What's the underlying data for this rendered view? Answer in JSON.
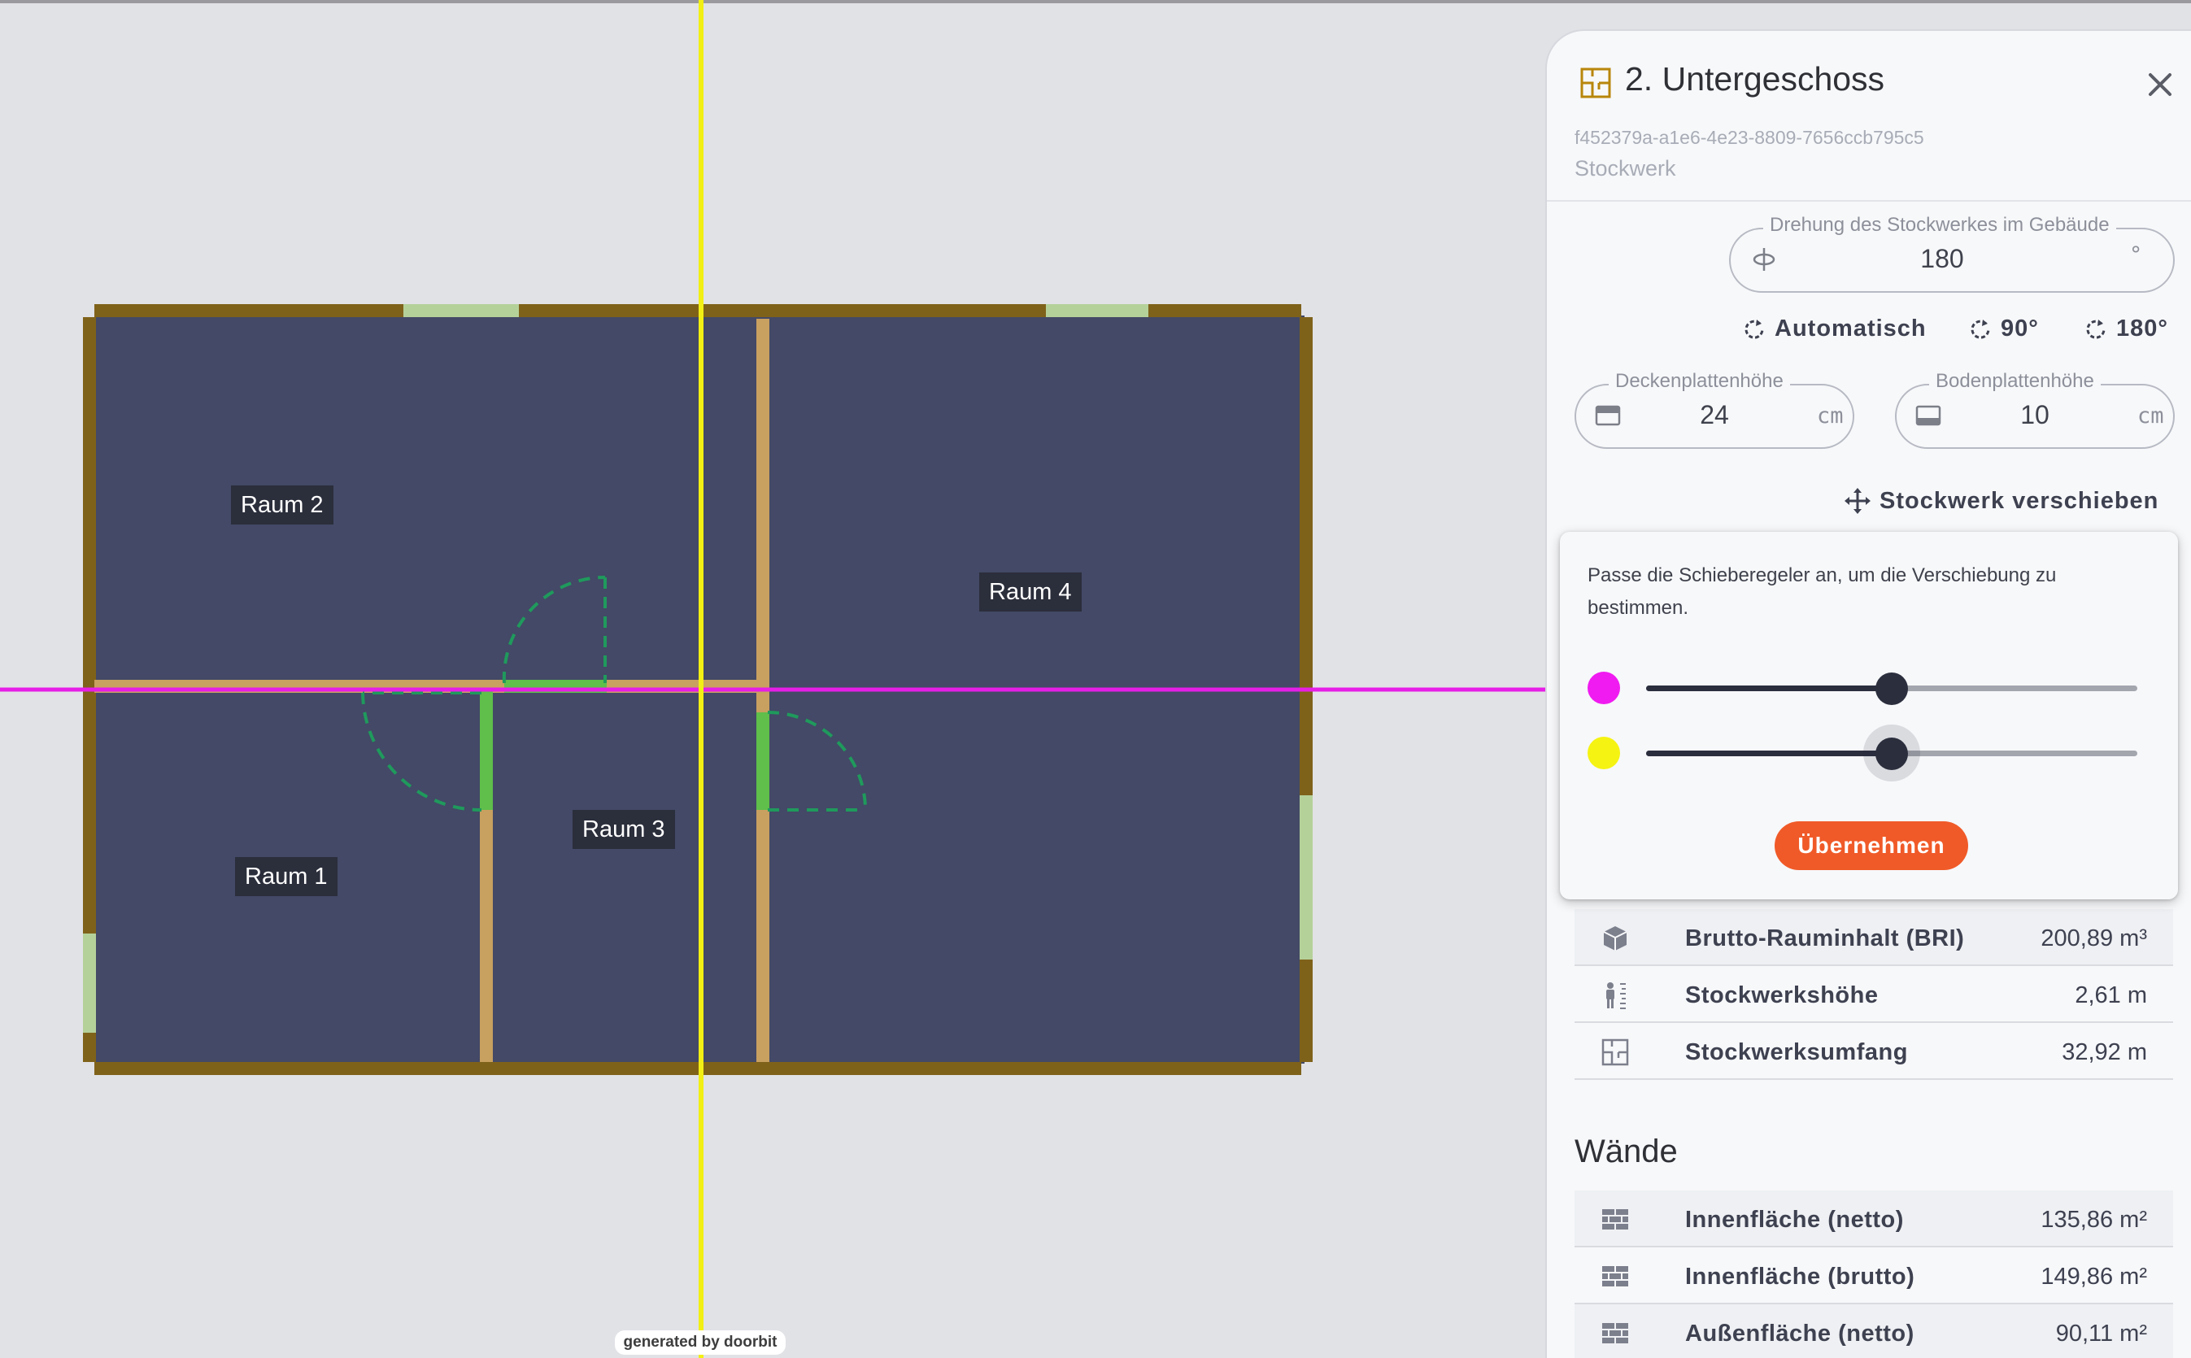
{
  "plan": {
    "rooms": [
      {
        "label": "Raum 2"
      },
      {
        "label": "Raum 4"
      },
      {
        "label": "Raum 3"
      },
      {
        "label": "Raum 1"
      }
    ],
    "watermark": "generated by doorbit",
    "colors": {
      "background": "#e1e2e6",
      "floor": "#434966",
      "exterior_wall": "#7f621a",
      "interior_wall": "#c8a060",
      "window": "#b5d19a",
      "door": "#5fbf4a",
      "door_swing": "#1f9a5c",
      "x_axis": "#e61ee6",
      "y_axis": "#f2ef14"
    }
  },
  "panel": {
    "title": "2. Untergeschoss",
    "uuid": "f452379a-a1e6-4e23-8809-7656ccb795c5",
    "type_label": "Stockwerk",
    "rotation": {
      "label": "Drehung des Stockwerkes im Gebäude",
      "value": "180",
      "unit": "°"
    },
    "rotation_buttons": {
      "auto": "Automatisch",
      "r90": "90°",
      "r180": "180°"
    },
    "ceiling": {
      "label": "Deckenplattenhöhe",
      "value": "24",
      "unit": "cm"
    },
    "floor": {
      "label": "Bodenplattenhöhe",
      "value": "10",
      "unit": "cm"
    },
    "move_button": "Stockwerk verschieben",
    "popover": {
      "text": "Passe die Schieberegeler an, um die Verschiebung zu bestimmen.",
      "slider_x": {
        "color": "#f01bf0",
        "value": 0.5
      },
      "slider_y": {
        "color": "#f5f312",
        "value": 0.5
      },
      "apply_label": "Übernehmen"
    },
    "stats": [
      {
        "icon": "cube-icon",
        "label": "Brutto-Rauminhalt (BRI)",
        "value": "200,89 m³"
      },
      {
        "icon": "person-height-icon",
        "label": "Stockwerkshöhe",
        "value": "2,61 m"
      },
      {
        "icon": "floorplan-icon",
        "label": "Stockwerksumfang",
        "value": "32,92 m"
      }
    ],
    "walls_title": "Wände",
    "walls": [
      {
        "icon": "brick-wall-icon",
        "label": "Innenfläche (netto)",
        "value": "135,86 m²"
      },
      {
        "icon": "brick-wall-icon",
        "label": "Innenfläche (brutto)",
        "value": "149,86 m²"
      },
      {
        "icon": "brick-wall-icon",
        "label": "Außenfläche (netto)",
        "value": "90,11 m²"
      }
    ]
  }
}
